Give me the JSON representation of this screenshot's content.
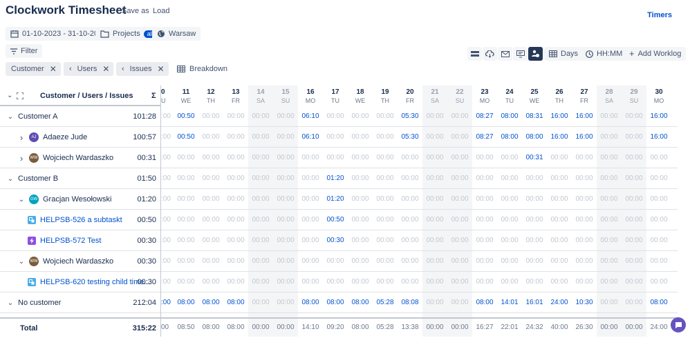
{
  "header": {
    "title": "Clockwork Timesheet",
    "save_as": "Save as",
    "load": "Load",
    "timers": "Timers"
  },
  "toolbar": {
    "date_range": "01-10-2023 - 31-10-2023",
    "projects_label": "Projects",
    "projects_badge": "all",
    "timezone": "Warsaw",
    "filter": "Filter",
    "days": "Days",
    "time_format": "HH:MM",
    "add_worklog": "Add Worklog",
    "breakdown": "Breakdown",
    "chips": [
      "Customer",
      "Users",
      "Issues"
    ]
  },
  "grid": {
    "header_label": "Customer / Users / Issues",
    "sigma": "Σ",
    "days": [
      {
        "d": "10",
        "w": "TU",
        "we": false,
        "partial": true
      },
      {
        "d": "11",
        "w": "WE",
        "we": false
      },
      {
        "d": "12",
        "w": "TH",
        "we": false
      },
      {
        "d": "13",
        "w": "FR",
        "we": false
      },
      {
        "d": "14",
        "w": "SA",
        "we": true
      },
      {
        "d": "15",
        "w": "SU",
        "we": true
      },
      {
        "d": "16",
        "w": "MO",
        "we": false
      },
      {
        "d": "17",
        "w": "TU",
        "we": false
      },
      {
        "d": "18",
        "w": "WE",
        "we": false
      },
      {
        "d": "19",
        "w": "TH",
        "we": false
      },
      {
        "d": "20",
        "w": "FR",
        "we": false
      },
      {
        "d": "21",
        "w": "SA",
        "we": true
      },
      {
        "d": "22",
        "w": "SU",
        "we": true
      },
      {
        "d": "23",
        "w": "MO",
        "we": false
      },
      {
        "d": "24",
        "w": "TU",
        "we": false
      },
      {
        "d": "25",
        "w": "WE",
        "we": false
      },
      {
        "d": "26",
        "w": "TH",
        "we": false
      },
      {
        "d": "27",
        "w": "FR",
        "we": false
      },
      {
        "d": "28",
        "w": "SA",
        "we": true
      },
      {
        "d": "29",
        "w": "SU",
        "we": true
      },
      {
        "d": "30",
        "w": "MO",
        "we": false
      }
    ],
    "rows": [
      {
        "kind": "group",
        "name": "Customer A",
        "total": "101:28",
        "values": [
          "00:00",
          "00:50",
          "00:00",
          "00:00",
          "00:00",
          "00:00",
          "06:10",
          "00:00",
          "00:00",
          "00:00",
          "05:30",
          "00:00",
          "00:00",
          "08:27",
          "08:00",
          "08:31",
          "16:00",
          "16:00",
          "00:00",
          "00:00",
          "16:00"
        ]
      },
      {
        "kind": "user",
        "name": "Adaeze Jude",
        "avatar": "AJ",
        "avatar_color": "#5e4db2",
        "total": "100:57",
        "values": [
          "00:00",
          "00:50",
          "00:00",
          "00:00",
          "00:00",
          "00:00",
          "06:10",
          "00:00",
          "00:00",
          "00:00",
          "05:30",
          "00:00",
          "00:00",
          "08:27",
          "08:00",
          "08:00",
          "16:00",
          "16:00",
          "00:00",
          "00:00",
          "16:00"
        ]
      },
      {
        "kind": "user",
        "name": "Wojciech Wardaszko",
        "avatar": "WW",
        "avatar_color": "#7a5c3c",
        "total": "00:31",
        "values": [
          "00:00",
          "00:00",
          "00:00",
          "00:00",
          "00:00",
          "00:00",
          "00:00",
          "00:00",
          "00:00",
          "00:00",
          "00:00",
          "00:00",
          "00:00",
          "00:00",
          "00:00",
          "00:31",
          "00:00",
          "00:00",
          "00:00",
          "00:00",
          "00:00"
        ]
      },
      {
        "kind": "group",
        "name": "Customer B",
        "total": "01:50",
        "values": [
          "00:00",
          "00:00",
          "00:00",
          "00:00",
          "00:00",
          "00:00",
          "00:00",
          "01:20",
          "00:00",
          "00:00",
          "00:00",
          "00:00",
          "00:00",
          "00:00",
          "00:00",
          "00:00",
          "00:00",
          "00:00",
          "00:00",
          "00:00",
          "00:00"
        ]
      },
      {
        "kind": "user_open",
        "name": "Gracjan Wesołowski",
        "avatar": "GW",
        "avatar_color": "#00a3bf",
        "total": "01:20",
        "values": [
          "00:00",
          "00:00",
          "00:00",
          "00:00",
          "00:00",
          "00:00",
          "00:00",
          "01:20",
          "00:00",
          "00:00",
          "00:00",
          "00:00",
          "00:00",
          "00:00",
          "00:00",
          "00:00",
          "00:00",
          "00:00",
          "00:00",
          "00:00",
          "00:00"
        ]
      },
      {
        "kind": "issue",
        "name": "HELPSB-526 a subtaskt",
        "issue_type": "subtask",
        "total": "00:50",
        "values": [
          "00:00",
          "00:00",
          "00:00",
          "00:00",
          "00:00",
          "00:00",
          "00:00",
          "00:50",
          "00:00",
          "00:00",
          "00:00",
          "00:00",
          "00:00",
          "00:00",
          "00:00",
          "00:00",
          "00:00",
          "00:00",
          "00:00",
          "00:00",
          "00:00"
        ]
      },
      {
        "kind": "issue",
        "name": "HELPSB-572 Test",
        "issue_type": "epic",
        "total": "00:30",
        "values": [
          "00:00",
          "00:00",
          "00:00",
          "00:00",
          "00:00",
          "00:00",
          "00:00",
          "00:30",
          "00:00",
          "00:00",
          "00:00",
          "00:00",
          "00:00",
          "00:00",
          "00:00",
          "00:00",
          "00:00",
          "00:00",
          "00:00",
          "00:00",
          "00:00"
        ]
      },
      {
        "kind": "user_open",
        "name": "Wojciech Wardaszko",
        "avatar": "WW",
        "avatar_color": "#7a5c3c",
        "total": "00:30",
        "values": [
          "00:00",
          "00:00",
          "00:00",
          "00:00",
          "00:00",
          "00:00",
          "00:00",
          "00:00",
          "00:00",
          "00:00",
          "00:00",
          "00:00",
          "00:00",
          "00:00",
          "00:00",
          "00:00",
          "00:00",
          "00:00",
          "00:00",
          "00:00",
          "00:00"
        ]
      },
      {
        "kind": "issue",
        "name": "HELPSB-620 testing child time...",
        "issue_type": "subtask",
        "total": "00:30",
        "values": [
          "00:00",
          "00:00",
          "00:00",
          "00:00",
          "00:00",
          "00:00",
          "00:00",
          "00:00",
          "00:00",
          "00:00",
          "00:00",
          "00:00",
          "00:00",
          "00:00",
          "00:00",
          "00:00",
          "00:00",
          "00:00",
          "00:00",
          "00:00",
          "00:00"
        ]
      },
      {
        "kind": "group",
        "name": "No customer",
        "total": "212:04",
        "values": [
          ":00",
          "08:00",
          "08:00",
          "08:00",
          "00:00",
          "00:00",
          "08:00",
          "08:00",
          "08:00",
          "05:28",
          "08:08",
          "00:00",
          "00:00",
          "08:00",
          "14:01",
          "16:01",
          "24:00",
          "10:30",
          "00:00",
          "00:00",
          "08:00"
        ]
      }
    ],
    "total_label": "Total",
    "total_value": "315:22",
    "total_values": [
      "00",
      "08:50",
      "08:00",
      "08:00",
      "00:00",
      "00:00",
      "14:10",
      "09:20",
      "08:00",
      "05:28",
      "13:38",
      "00:00",
      "00:00",
      "16:27",
      "22:01",
      "24:32",
      "40:00",
      "26:30",
      "00:00",
      "00:00",
      "24:00"
    ]
  },
  "colors": {
    "accent": "#0052cc",
    "active_toggle": "#253858",
    "help_fab": "#6554c0"
  }
}
